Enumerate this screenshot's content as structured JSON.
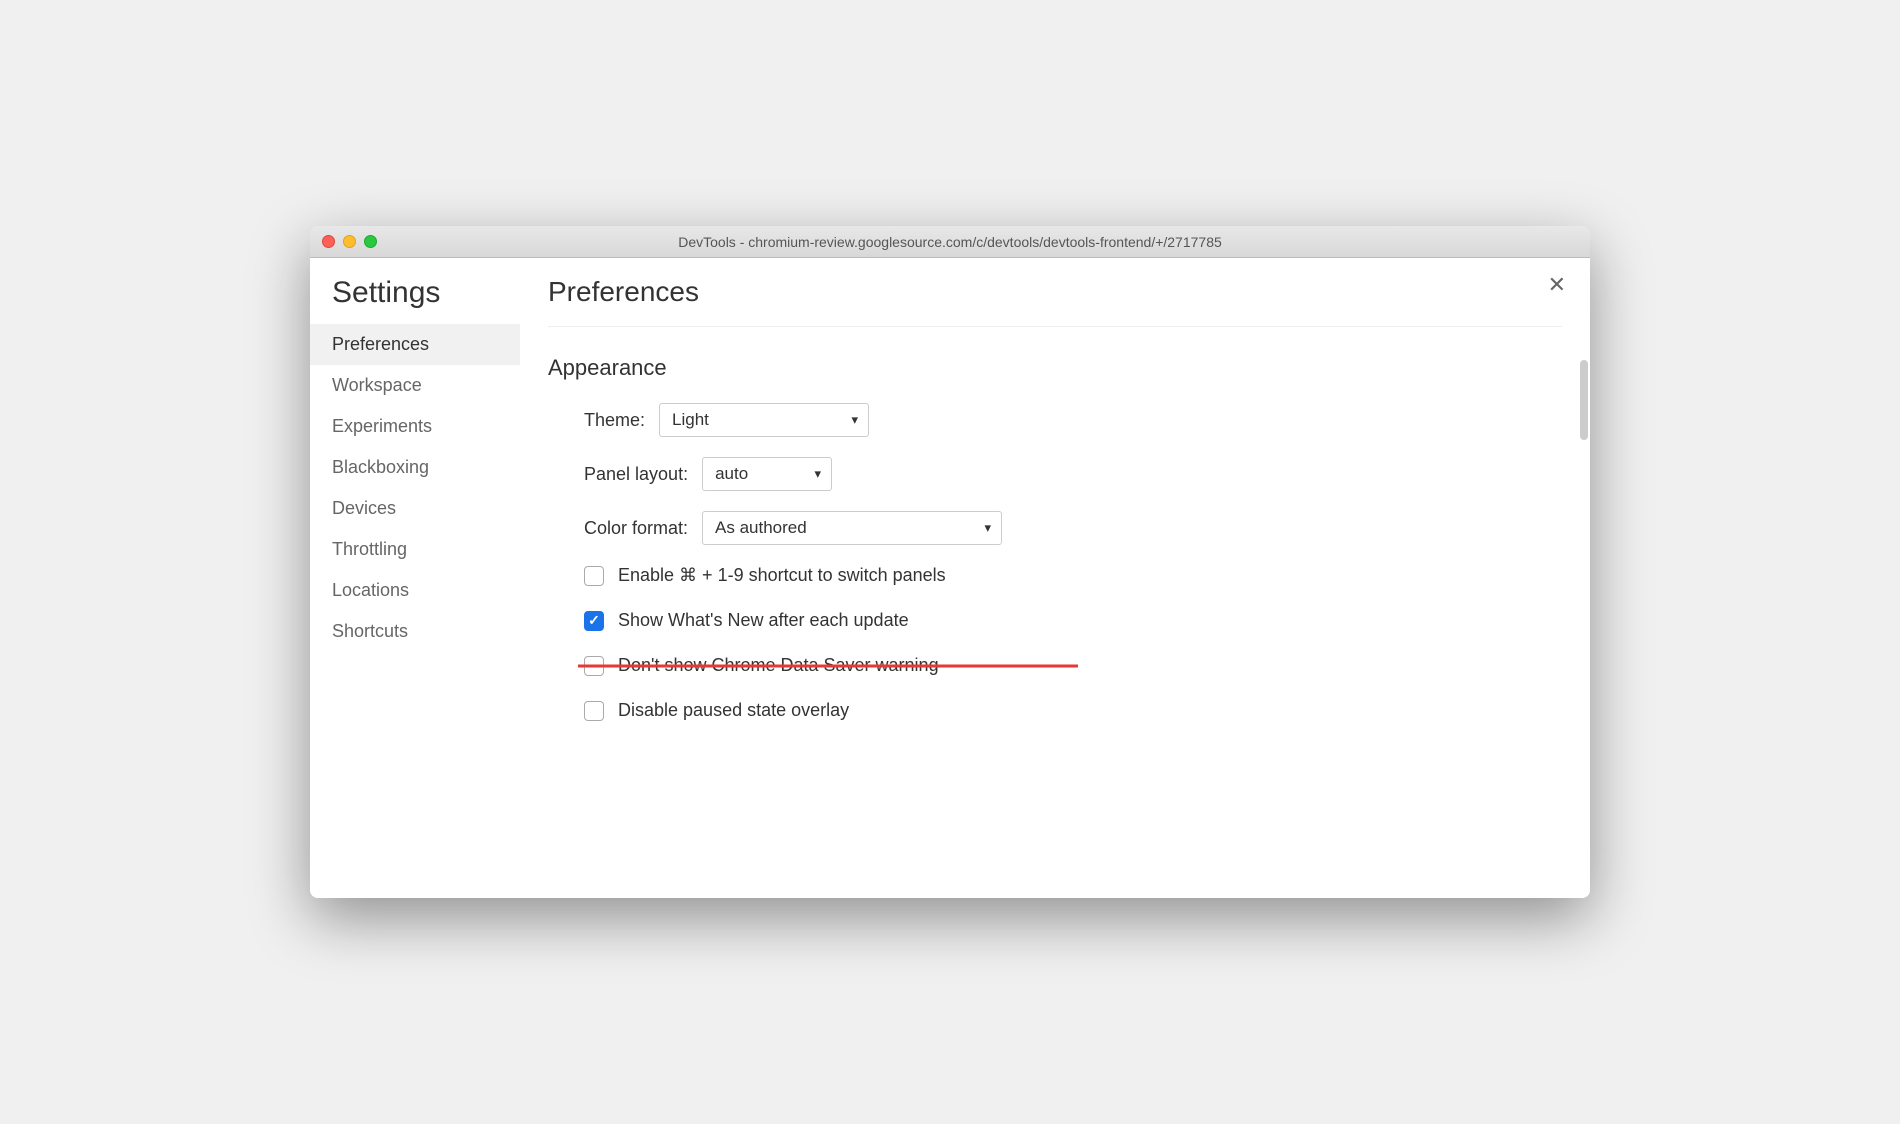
{
  "window": {
    "title": "DevTools - chromium-review.googlesource.com/c/devtools/devtools-frontend/+/2717785"
  },
  "sidebar": {
    "title": "Settings",
    "items": [
      {
        "label": "Preferences",
        "active": true
      },
      {
        "label": "Workspace",
        "active": false
      },
      {
        "label": "Experiments",
        "active": false
      },
      {
        "label": "Blackboxing",
        "active": false
      },
      {
        "label": "Devices",
        "active": false
      },
      {
        "label": "Throttling",
        "active": false
      },
      {
        "label": "Locations",
        "active": false
      },
      {
        "label": "Shortcuts",
        "active": false
      }
    ]
  },
  "main": {
    "title": "Preferences",
    "section": "Appearance",
    "theme": {
      "label": "Theme:",
      "value": "Light"
    },
    "panelLayout": {
      "label": "Panel layout:",
      "value": "auto"
    },
    "colorFormat": {
      "label": "Color format:",
      "value": "As authored"
    },
    "checkboxes": [
      {
        "label": "Enable ⌘ + 1-9 shortcut to switch panels",
        "checked": false,
        "strikethrough": false
      },
      {
        "label": "Show What's New after each update",
        "checked": true,
        "strikethrough": false
      },
      {
        "label": "Don't show Chrome Data Saver warning",
        "checked": false,
        "strikethrough": true
      },
      {
        "label": "Disable paused state overlay",
        "checked": false,
        "strikethrough": false
      }
    ]
  }
}
